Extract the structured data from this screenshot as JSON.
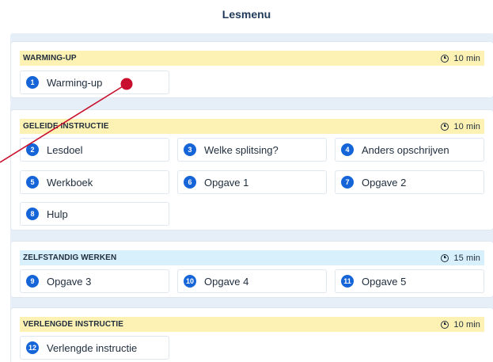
{
  "page": {
    "title": "Lesmenu"
  },
  "sections": [
    {
      "label": "WARMING-UP",
      "time": "10 min",
      "items": [
        {
          "num": "1",
          "label": "Warming-up"
        }
      ]
    },
    {
      "label": "GELEIDE INSTRUCTIE",
      "time": "10 min",
      "items": [
        {
          "num": "2",
          "label": "Lesdoel"
        },
        {
          "num": "3",
          "label": "Welke splitsing?"
        },
        {
          "num": "4",
          "label": "Anders opschrijven"
        },
        {
          "num": "5",
          "label": "Werkboek"
        },
        {
          "num": "6",
          "label": "Opgave 1"
        },
        {
          "num": "7",
          "label": "Opgave 2"
        },
        {
          "num": "8",
          "label": "Hulp"
        }
      ]
    },
    {
      "label": "ZELFSTANDIG WERKEN",
      "time": "15 min",
      "items": [
        {
          "num": "9",
          "label": "Opgave 3"
        },
        {
          "num": "10",
          "label": "Opgave 4"
        },
        {
          "num": "11",
          "label": "Opgave 5"
        }
      ]
    },
    {
      "label": "VERLENGDE INSTRUCTIE",
      "time": "10 min",
      "items": [
        {
          "num": "12",
          "label": "Verlengde instructie"
        }
      ]
    }
  ],
  "colors": {
    "accent": "#1565d8",
    "header_yellow": "#fdf2b3",
    "header_blue": "#d8f0fb",
    "pointer": "#c8102e"
  }
}
